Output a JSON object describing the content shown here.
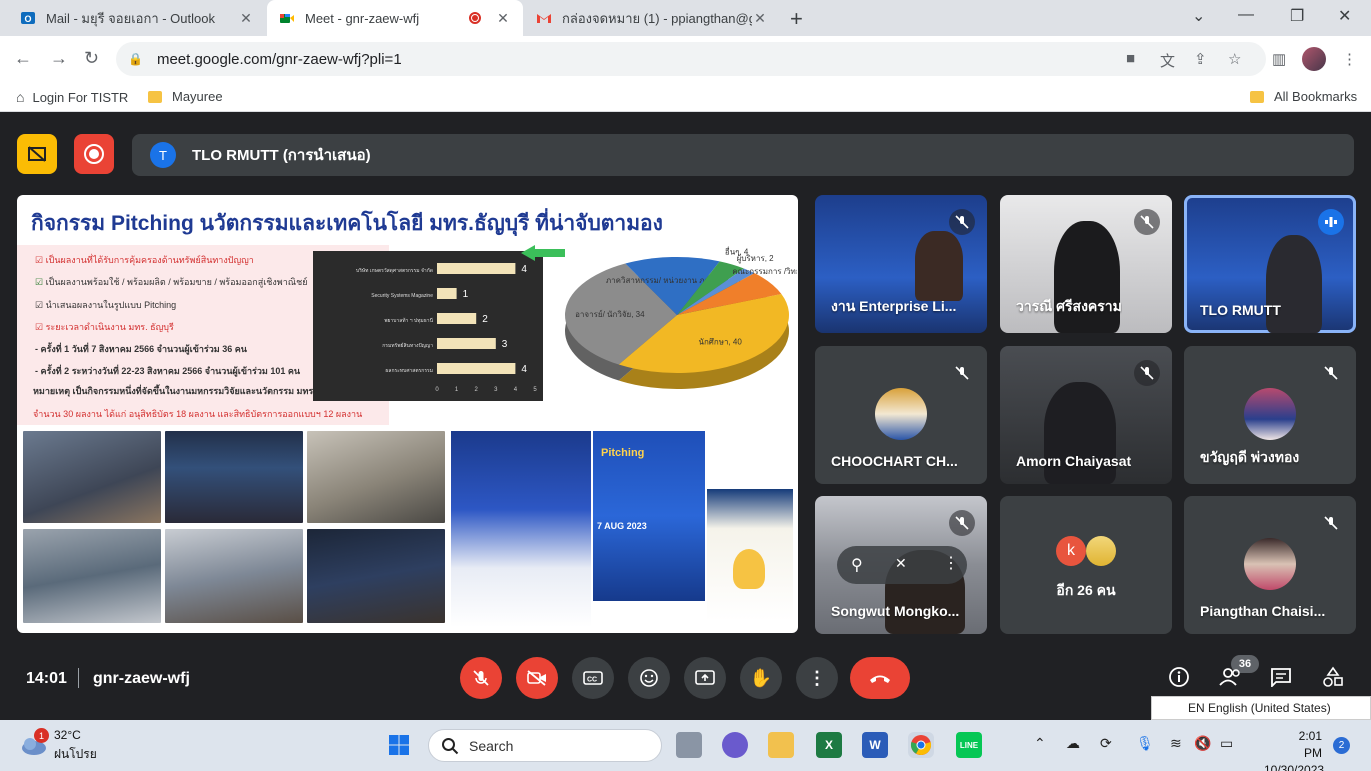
{
  "browser": {
    "tabs": [
      {
        "label": "Mail - มยุรี จอยเอกา - Outlook"
      },
      {
        "label": "Meet - gnr-zaew-wfj"
      },
      {
        "label": "กล่องจดหมาย (1) - ppiangthan@g"
      }
    ],
    "url": "meet.google.com/gnr-zaew-wfj?pli=1",
    "bookmarks": [
      "Login For TISTR",
      "Mayuree"
    ],
    "all_bookmarks": "All Bookmarks"
  },
  "meet": {
    "presenter_initial": "T",
    "presenter_label": "TLO RMUTT (การนำเสนอ)",
    "time": "14:01",
    "meeting_code": "gnr-zaew-wfj",
    "participant_count": "36",
    "slide": {
      "title": "กิจกรรม Pitching นวัตกรรมและเทคโนโลยี มทร.ธัญบุรี ที่น่าจับตามอง",
      "bullets": [
        "เป็นผลงานที่ได้รับการคุ้มครองด้านทรัพย์สินทางปัญญา",
        "เป็นผลงานพร้อมใช้ / พร้อมผลิต / พร้อมขาย / พร้อมออกสู่เชิงพาณิชย์",
        "นำเสนอผลงานในรูปแบบ Pitching",
        "ระยะเวลาดำเนินงาน มทร. ธัญบุรี",
        "ครั้งที่ 1 วันที่ 7 สิงหาคม 2566 จำนวนผู้เข้าร่วม 36 คน",
        "ครั้งที่ 2 ระหว่างวันที่ 22-23 สิงหาคม 2566 จำนวนผู้เข้าร่วม 101 คน",
        "หมายเหตุ เป็นกิจกรรมหนึ่งที่จัดขึ้นในงานมหกรรมวิจัยและนวัตกรรม มทร.ธัญบุรี",
        "จำนวน 30 ผลงาน ได้แก่ อนุสิทธิบัตร 18 ผลงาน และสิทธิบัตรการออกแบบฯ 12 ผลงาน"
      ],
      "poster_date": "7 AUG 2023",
      "poster_word": "Pitching"
    }
  },
  "chart_data": [
    {
      "type": "bar",
      "categories": [
        "บริษัท เกษตรวัสดุศาสตรกรรม จำกัด",
        "Security Systems Magazine",
        "พยาบาลท้า ฯ ปทุมธานี",
        "กรมทรัพย์สินทางปัญญา",
        "ผลกระทบศาสตรกรรม"
      ],
      "values": [
        4,
        1,
        2,
        3,
        4
      ],
      "xlim": [
        0,
        5
      ],
      "xticks": [
        "0",
        "1",
        "2",
        "3",
        "4",
        "5"
      ]
    },
    {
      "type": "pie",
      "slices": [
        {
          "label": "นักศึกษา, 40",
          "value": 40,
          "color": "#f2b824"
        },
        {
          "label": "อาจารย์/ นักวิจัย, 34",
          "value": 34,
          "color": "#8c8c8c"
        },
        {
          "label": "ภาควิสาหกรรม/ หน่วยงาน ภายนอก, 14",
          "value": 14,
          "color": "#2f6fc4"
        },
        {
          "label": "อื่นๆ, 4",
          "value": 4,
          "color": "#3f9f4f"
        },
        {
          "label": "ผู้บริหาร, 2",
          "value": 2,
          "color": "#5b8fd6"
        },
        {
          "label": "คณะกรรมการ /วิทยากร, 7",
          "value": 7,
          "color": "#f07f2a"
        }
      ]
    }
  ],
  "participants": [
    {
      "name": "งาน Enterprise Li..."
    },
    {
      "name": "วารณี ศรีสงคราม"
    },
    {
      "name": "TLO RMUTT"
    },
    {
      "name": "CHOOCHART CH..."
    },
    {
      "name": "Amorn Chaiyasat"
    },
    {
      "name": "ขวัญฤดี พ่วงทอง"
    },
    {
      "name": "Songwut Mongko..."
    },
    {
      "name": "อีก 26 คน",
      "avatar_letter": "k"
    },
    {
      "name": "Piangthan Chaisi..."
    }
  ],
  "ime": "EN English (United States)",
  "taskbar": {
    "weather_temp": "32°C",
    "weather_desc": "ฝนโปรย",
    "weather_badge": "1",
    "search": "Search",
    "time": "2:01 PM",
    "date": "10/30/2023",
    "notifications": "2"
  },
  "colors": {
    "accent": "#1a73e8",
    "danger": "#ea4335",
    "bg": "#202124",
    "tile": "#3c4043"
  }
}
